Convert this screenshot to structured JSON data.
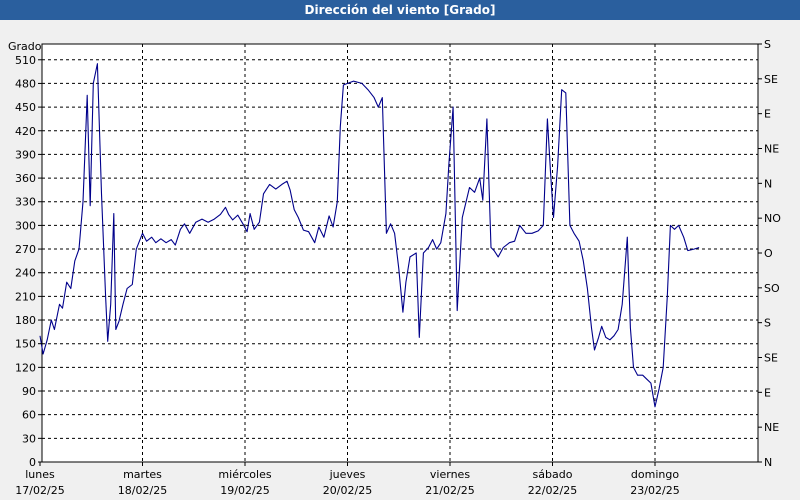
{
  "window": {
    "title": "Dirección del viento [Grado]"
  },
  "chart_data": {
    "type": "line",
    "title": "Dirección del viento [Grado]",
    "ylabel": "Grado",
    "ylim": [
      0,
      530
    ],
    "y_ticks": [
      0,
      30,
      60,
      90,
      120,
      150,
      180,
      210,
      240,
      270,
      300,
      330,
      360,
      390,
      420,
      450,
      480,
      510
    ],
    "right_axis_labels": [
      {
        "value": 0,
        "label": "N"
      },
      {
        "value": 45,
        "label": "NE"
      },
      {
        "value": 90,
        "label": "E"
      },
      {
        "value": 135,
        "label": "SE"
      },
      {
        "value": 180,
        "label": "S"
      },
      {
        "value": 225,
        "label": "SO"
      },
      {
        "value": 270,
        "label": "O"
      },
      {
        "value": 315,
        "label": "NO"
      },
      {
        "value": 360,
        "label": "N"
      },
      {
        "value": 405,
        "label": "NE"
      },
      {
        "value": 450,
        "label": "E"
      },
      {
        "value": 495,
        "label": "SE"
      },
      {
        "value": 540,
        "label": "S"
      }
    ],
    "x_days": [
      {
        "day": "lunes",
        "date": "17/02/25"
      },
      {
        "day": "martes",
        "date": "18/02/25"
      },
      {
        "day": "miércoles",
        "date": "19/02/25"
      },
      {
        "day": "jueves",
        "date": "20/02/25"
      },
      {
        "day": "viernes",
        "date": "21/02/25"
      },
      {
        "day": "sábado",
        "date": "22/02/25"
      },
      {
        "day": "domingo",
        "date": "23/02/25"
      }
    ],
    "x_unit": "days since 17/02/25 00:00",
    "xlim": [
      0,
      7
    ],
    "series_color": "#00008b",
    "series": [
      {
        "points": [
          [
            0.0,
            160
          ],
          [
            0.03,
            137
          ],
          [
            0.07,
            155
          ],
          [
            0.11,
            180
          ],
          [
            0.14,
            168
          ],
          [
            0.19,
            200
          ],
          [
            0.22,
            195
          ],
          [
            0.26,
            228
          ],
          [
            0.3,
            220
          ],
          [
            0.34,
            255
          ],
          [
            0.38,
            270
          ],
          [
            0.42,
            330
          ],
          [
            0.46,
            465
          ],
          [
            0.49,
            325
          ],
          [
            0.52,
            480
          ],
          [
            0.56,
            505
          ],
          [
            0.6,
            340
          ],
          [
            0.64,
            210
          ],
          [
            0.66,
            153
          ],
          [
            0.69,
            200
          ],
          [
            0.72,
            315
          ],
          [
            0.74,
            168
          ],
          [
            0.77,
            178
          ],
          [
            0.81,
            200
          ],
          [
            0.85,
            220
          ],
          [
            0.9,
            225
          ],
          [
            0.94,
            270
          ],
          [
            1.0,
            290
          ],
          [
            1.04,
            280
          ],
          [
            1.09,
            285
          ],
          [
            1.13,
            278
          ],
          [
            1.18,
            283
          ],
          [
            1.23,
            278
          ],
          [
            1.28,
            282
          ],
          [
            1.32,
            275
          ],
          [
            1.37,
            295
          ],
          [
            1.41,
            302
          ],
          [
            1.46,
            290
          ],
          [
            1.52,
            304
          ],
          [
            1.58,
            308
          ],
          [
            1.64,
            304
          ],
          [
            1.7,
            308
          ],
          [
            1.76,
            314
          ],
          [
            1.81,
            323
          ],
          [
            1.84,
            314
          ],
          [
            1.88,
            307
          ],
          [
            1.93,
            313
          ],
          [
            1.98,
            302
          ],
          [
            2.02,
            292
          ],
          [
            2.05,
            315
          ],
          [
            2.09,
            295
          ],
          [
            2.14,
            304
          ],
          [
            2.18,
            340
          ],
          [
            2.24,
            352
          ],
          [
            2.3,
            346
          ],
          [
            2.36,
            352
          ],
          [
            2.41,
            356
          ],
          [
            2.44,
            345
          ],
          [
            2.48,
            320
          ],
          [
            2.52,
            310
          ],
          [
            2.57,
            294
          ],
          [
            2.62,
            292
          ],
          [
            2.68,
            278
          ],
          [
            2.72,
            298
          ],
          [
            2.77,
            285
          ],
          [
            2.82,
            312
          ],
          [
            2.86,
            298
          ],
          [
            2.9,
            330
          ],
          [
            2.93,
            425
          ],
          [
            2.96,
            478
          ],
          [
            3.0,
            480
          ],
          [
            3.06,
            483
          ],
          [
            3.14,
            480
          ],
          [
            3.2,
            472
          ],
          [
            3.26,
            462
          ],
          [
            3.3,
            450
          ],
          [
            3.34,
            462
          ],
          [
            3.38,
            290
          ],
          [
            3.42,
            302
          ],
          [
            3.46,
            290
          ],
          [
            3.5,
            245
          ],
          [
            3.54,
            190
          ],
          [
            3.57,
            228
          ],
          [
            3.61,
            260
          ],
          [
            3.67,
            265
          ],
          [
            3.7,
            158
          ],
          [
            3.74,
            265
          ],
          [
            3.79,
            272
          ],
          [
            3.83,
            282
          ],
          [
            3.87,
            270
          ],
          [
            3.91,
            278
          ],
          [
            3.96,
            315
          ],
          [
            3.99,
            380
          ],
          [
            4.03,
            450
          ],
          [
            4.07,
            192
          ],
          [
            4.12,
            310
          ],
          [
            4.19,
            348
          ],
          [
            4.24,
            342
          ],
          [
            4.29,
            360
          ],
          [
            4.32,
            332
          ],
          [
            4.36,
            435
          ],
          [
            4.4,
            272
          ],
          [
            4.43,
            268
          ],
          [
            4.47,
            260
          ],
          [
            4.52,
            272
          ],
          [
            4.58,
            278
          ],
          [
            4.63,
            280
          ],
          [
            4.68,
            300
          ],
          [
            4.74,
            290
          ],
          [
            4.8,
            290
          ],
          [
            4.86,
            293
          ],
          [
            4.91,
            300
          ],
          [
            4.95,
            435
          ],
          [
            4.98,
            368
          ],
          [
            5.01,
            310
          ],
          [
            5.05,
            375
          ],
          [
            5.09,
            472
          ],
          [
            5.13,
            468
          ],
          [
            5.17,
            300
          ],
          [
            5.21,
            290
          ],
          [
            5.26,
            280
          ],
          [
            5.3,
            255
          ],
          [
            5.34,
            220
          ],
          [
            5.38,
            170
          ],
          [
            5.41,
            142
          ],
          [
            5.45,
            158
          ],
          [
            5.48,
            172
          ],
          [
            5.52,
            158
          ],
          [
            5.56,
            155
          ],
          [
            5.6,
            160
          ],
          [
            5.64,
            168
          ],
          [
            5.68,
            200
          ],
          [
            5.73,
            285
          ],
          [
            5.76,
            170
          ],
          [
            5.79,
            120
          ],
          [
            5.83,
            110
          ],
          [
            5.88,
            110
          ],
          [
            5.92,
            105
          ],
          [
            5.96,
            100
          ],
          [
            6.0,
            70
          ],
          [
            6.04,
            93
          ],
          [
            6.08,
            120
          ],
          [
            6.12,
            210
          ],
          [
            6.15,
            300
          ],
          [
            6.19,
            295
          ],
          [
            6.23,
            300
          ],
          [
            6.28,
            285
          ],
          [
            6.32,
            268
          ],
          [
            6.38,
            270
          ],
          [
            6.43,
            272
          ]
        ]
      }
    ]
  }
}
